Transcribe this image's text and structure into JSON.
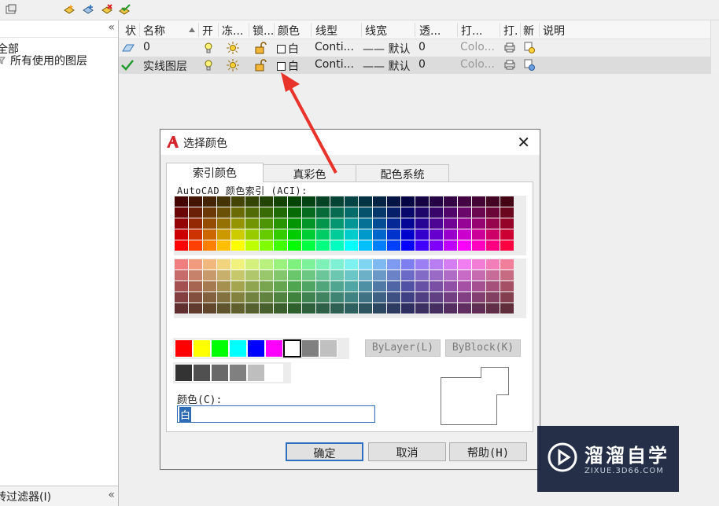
{
  "left_panel": {
    "tree_root": "全部",
    "tree_child": "所有使用的图层",
    "footer_text": "转过滤器(I)",
    "collapse_glyph": "«"
  },
  "layer_list": {
    "columns": [
      "状",
      "名称",
      "开",
      "冻...",
      "锁...",
      "颜色",
      "线型",
      "线宽",
      "透...",
      "打...",
      "打.",
      "新",
      "说明"
    ],
    "rows": [
      {
        "name": "0",
        "color_name": "白",
        "linetype": "Conti...",
        "lineweight": "—— 默认",
        "transparency": "0",
        "plot_style": "Colo..."
      },
      {
        "name": "实线图层",
        "color_name": "白",
        "linetype": "Conti...",
        "lineweight": "—— 默认",
        "transparency": "0",
        "plot_style": "Colo..."
      }
    ]
  },
  "dialog": {
    "title": "选择颜色",
    "tabs": [
      "索引颜色",
      "真彩色",
      "配色系统"
    ],
    "aci_label": "AutoCAD 颜色索引 (ACI):",
    "bylayer_label": "ByLayer(L)",
    "byblock_label": "ByBlock(K)",
    "color_field_label": "颜色(C):",
    "color_field_value": "白",
    "ok_label": "确定",
    "cancel_label": "取消",
    "help_label": "帮助(H)",
    "standard_colors": [
      "#ff0000",
      "#ffff00",
      "#00ff00",
      "#00ffff",
      "#0000ff",
      "#ff00ff",
      "#ffffff",
      "#808080",
      "#c0c0c0"
    ],
    "gray_colors": [
      "#333333",
      "#505050",
      "#696969",
      "#808080",
      "#bebebe",
      "#ffffff"
    ]
  },
  "watermark": {
    "brand_cn": "溜溜自学",
    "brand_en": "ZIXUE.3D66.COM"
  }
}
